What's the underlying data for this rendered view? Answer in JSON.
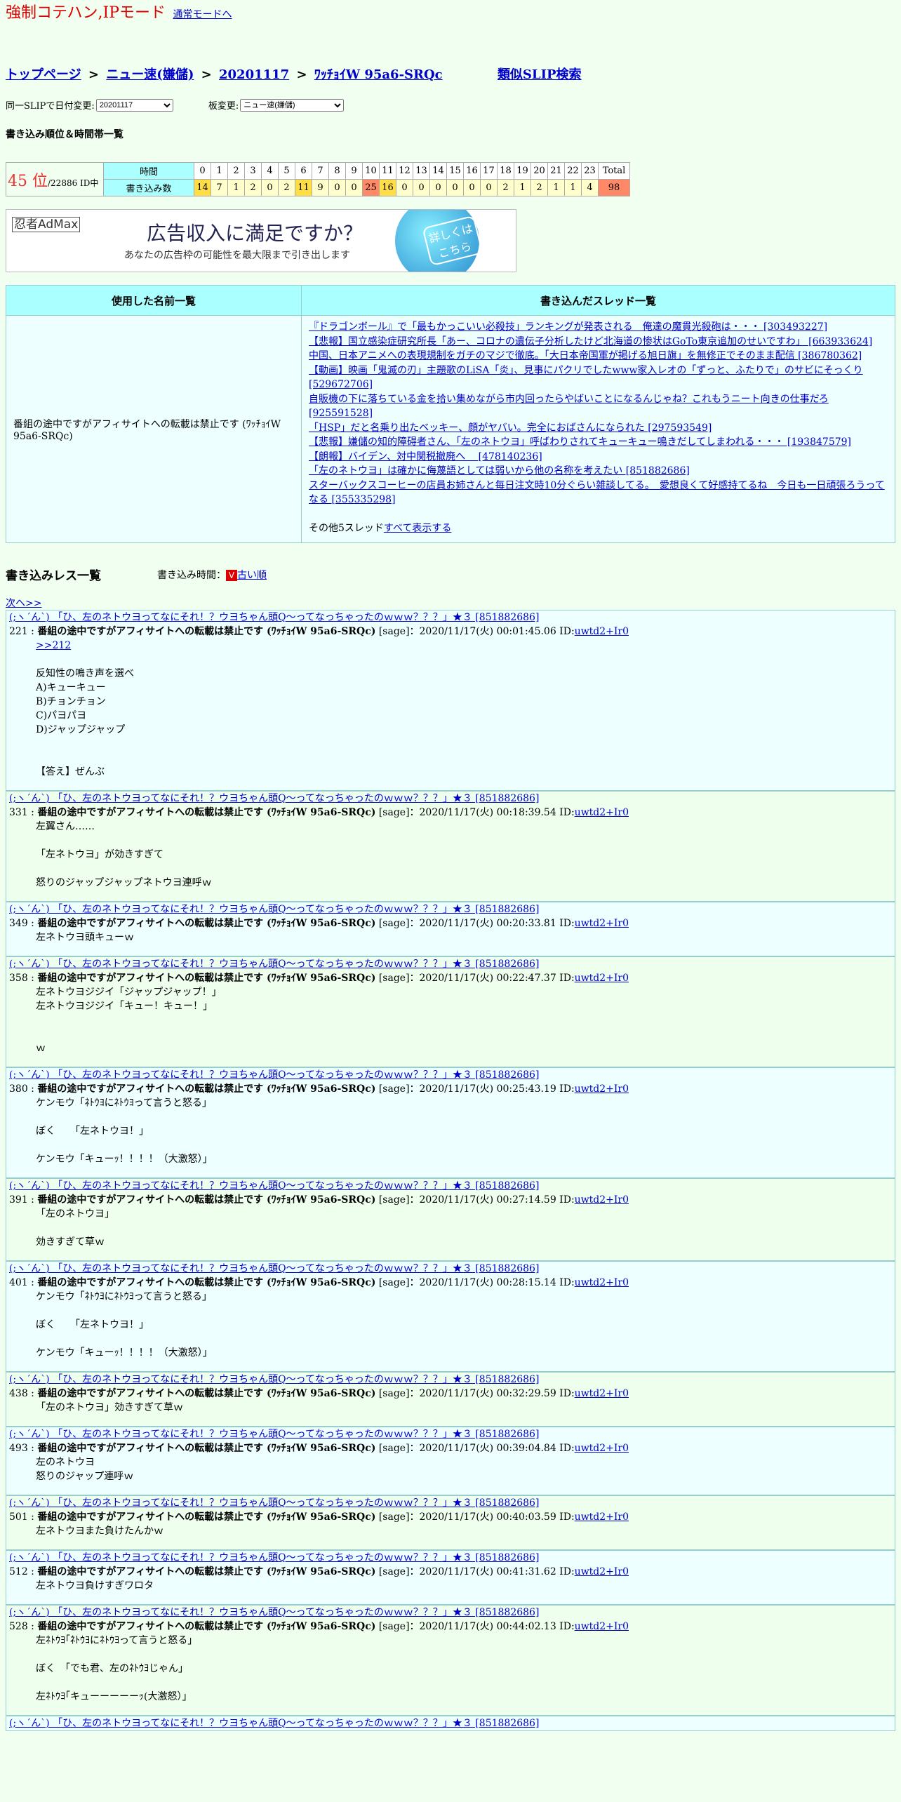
{
  "mode": {
    "title": "強制コテハン,IPモード",
    "link": "通常モードへ"
  },
  "breadcrumb": {
    "top": "トップページ",
    "sep": ">",
    "board": "ニュー速(嫌儲)",
    "date": "20201117",
    "slip": "ﾜｯﾁｮｲW 95a6-SRQc",
    "search": "類似SLIP検索"
  },
  "selects": {
    "date_label": "同一SLIPで日付変更:",
    "date_value": "20201117",
    "board_label": "板変更:",
    "board_value": "ニュー速(嫌儲)"
  },
  "rank_title": "書き込み順位＆時間帯一覧",
  "rank": {
    "position": "45 位",
    "of": "/22886 ID中",
    "time_label": "時間",
    "count_label": "書き込み数",
    "hours": [
      "0",
      "1",
      "2",
      "3",
      "4",
      "5",
      "6",
      "7",
      "8",
      "9",
      "10",
      "11",
      "12",
      "13",
      "14",
      "15",
      "16",
      "17",
      "18",
      "19",
      "20",
      "21",
      "22",
      "23"
    ],
    "counts": [
      "14",
      "7",
      "1",
      "2",
      "0",
      "2",
      "11",
      "9",
      "0",
      "0",
      "25",
      "16",
      "0",
      "0",
      "0",
      "0",
      "0",
      "0",
      "2",
      "1",
      "2",
      "1",
      "1",
      "4"
    ],
    "total_label": "Total",
    "total": "98"
  },
  "ad": {
    "logo": "忍者AdMax",
    "headline": "広告収入に満足ですか？",
    "sub": "あなたの広告枠の可能性を最大限まで引き出します",
    "button": "詳しくはこちら"
  },
  "overview": {
    "name_header": "使用した名前一覧",
    "thread_header": "書き込んだスレッド一覧",
    "name": "番組の途中ですがアフィサイトへの転載は禁止です (ﾜｯﾁｮｲW 95a6-SRQc)",
    "threads": [
      "『ドラゴンボール』で「最もかっこいい必殺技」ランキングが発表される　俺達の魔貫光殺砲は・・・ [303493227]",
      "【悲報】国立感染症研究所長「あー、コロナの遺伝子分析したけど北海道の惨状はGoTo東京追加のせいですわ」 [663933624]",
      "中国、日本アニメへの表現規制をガチのマジで徹底。「大日本帝国軍が掲げる旭日旗」を無修正でそのまま配信 [386780362]",
      "【動画】映画「鬼滅の刃」主題歌のLiSA「炎」、見事にパクリでしたwww家入レオの「ずっと、ふたりで」のサビにそっくり [529672706]",
      "自販機の下に落ちている金を拾い集めながら市内回ったらやばいことになるんじゃね？これもうニート向きの仕事だろ [925591528]",
      "「HSP」だと名乗り出たベッキー、顔がヤバい。完全におばさんになられた [297593549]",
      "【悲報】嫌儲の知的障碍者さん、「左のネトウヨ」呼ばわりされてキューキュー鳴きだしてしまわれる・・・ [193847579]",
      "【朗報】バイデン、対中関税撤廃へ　 [478140236]",
      "「左のネトウヨ」は確かに侮蔑語としては弱いから他の名称を考えたい [851882686]",
      "スターバックスコーヒーの店員お姉さんと毎日注文時10分ぐらい雑談してる。　愛想良くて好感持てるね　今日も一日頑張ろうってなる [355335298]"
    ],
    "more_prefix": "その他5スレッド",
    "more_link": "すべて表示する"
  },
  "posts_header": {
    "title": "書き込みレス一覧",
    "time_label": "書き込み時間：",
    "v": "V",
    "order": "古い順"
  },
  "next": "次へ>>",
  "post_thread": "(;ヽ´ん`) 「ひ、左のネトウヨってなにそれ！？ウヨちゃん頭Q～ってなっちゃったのｗｗｗ？？？」★３ [851882686]",
  "post_name": "番組の途中ですがアフィサイトへの転載は禁止です (ﾜｯﾁｮｲW 95a6-SRQc)",
  "post_id": "uwtd2+Ir0",
  "posts": [
    {
      "no": "221",
      "date": "[sage]：2020/11/17(火) 00:01:45.06 ID:",
      "anchor": ">>212",
      "body": "\n反知性の鳴き声を選べ\nA)キューキュー\nB)チョンチョン\nC)パヨパヨ\nD)ジャップジャップ\n\n\n【答え】ぜんぶ"
    },
    {
      "no": "331",
      "date": "[sage]：2020/11/17(火) 00:18:39.54 ID:",
      "anchor": "",
      "body": "左翼さん……\n\n「左ネトウヨ」が効きすぎて\n\n怒りのジャップジャップネトウヨ連呼ｗ"
    },
    {
      "no": "349",
      "date": "[sage]：2020/11/17(火) 00:20:33.81 ID:",
      "anchor": "",
      "body": "左ネトウヨ頭キューｗ"
    },
    {
      "no": "358",
      "date": "[sage]：2020/11/17(火) 00:22:47.37 ID:",
      "anchor": "",
      "body": "左ネトウヨジジイ「ジャップジャップ！」\n左ネトウヨジジイ「キュー！キュー！」\n\n\nｗ"
    },
    {
      "no": "380",
      "date": "[sage]：2020/11/17(火) 00:25:43.19 ID:",
      "anchor": "",
      "body": "ケンモウ「ﾈﾄｳﾖにﾈﾄｳﾖって言うと怒る」\n\nぼく　　「左ネトウヨ！」\n\nケンモウ「キューｯ！！！！（大激怒）」"
    },
    {
      "no": "391",
      "date": "[sage]：2020/11/17(火) 00:27:14.59 ID:",
      "anchor": "",
      "body": "「左のネトウヨ」\n\n効きすぎて草ｗ"
    },
    {
      "no": "401",
      "date": "[sage]：2020/11/17(火) 00:28:15.14 ID:",
      "anchor": "",
      "body": "ケンモウ「ﾈﾄｳﾖにﾈﾄｳﾖって言うと怒る」\n\nぼく　　「左ネトウヨ！」\n\nケンモウ「キューｯ！！！！（大激怒）」"
    },
    {
      "no": "438",
      "date": "[sage]：2020/11/17(火) 00:32:29.59 ID:",
      "anchor": "",
      "body": "「左のネトウヨ」効きすぎて草ｗ"
    },
    {
      "no": "493",
      "date": "[sage]：2020/11/17(火) 00:39:04.84 ID:",
      "anchor": "",
      "body": "左のネトウヨ\n怒りのジャップ連呼ｗ"
    },
    {
      "no": "501",
      "date": "[sage]：2020/11/17(火) 00:40:03.59 ID:",
      "anchor": "",
      "body": "左ネトウヨまた負けたんかｗ"
    },
    {
      "no": "512",
      "date": "[sage]：2020/11/17(火) 00:41:31.62 ID:",
      "anchor": "",
      "body": "左ネトウヨ負けすぎワロタ"
    },
    {
      "no": "528",
      "date": "[sage]：2020/11/17(火) 00:44:02.13 ID:",
      "anchor": "",
      "body": "左ﾈﾄｳﾖ｢ﾈﾄｳﾖにﾈﾄｳﾖって言うと怒る｣\n\nぼく　「でも君、左のﾈﾄｳﾖじゃん」\n\n左ﾈﾄｳﾖ｢キューーーーーｯ(大激怒）｣"
    },
    {
      "no": "",
      "date": "",
      "anchor": "",
      "body": ""
    }
  ]
}
